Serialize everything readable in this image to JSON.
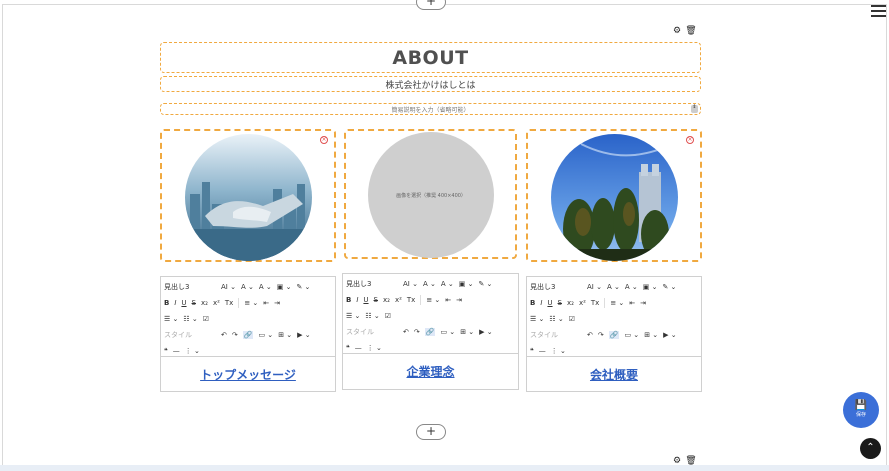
{
  "page": {
    "add_block_label": "+",
    "menu_icon": "hamburger-icon"
  },
  "block_tools": {
    "settings_icon": "⚙",
    "delete_icon": "🗑"
  },
  "about": {
    "title": "ABOUT",
    "subtitle": "株式会社かけはしとは",
    "description_placeholder": "簡易説明を入力（省略可能）",
    "spinner": "⇕"
  },
  "cards": [
    {
      "image_alt": "handshake over city",
      "remove_icon": "×",
      "toolbar": {
        "heading_select": "見出し3",
        "style_select": "スタイル"
      },
      "link_text": "トップメッセージ"
    },
    {
      "placeholder_text": "画像を選択（推奨 400×400）",
      "toolbar": {
        "heading_select": "見出し3",
        "style_select": "スタイル"
      },
      "link_text": "企業理念"
    },
    {
      "image_alt": "buildings and trees under blue sky",
      "remove_icon": "×",
      "toolbar": {
        "heading_select": "見出し3",
        "style_select": "スタイル"
      },
      "link_text": "会社概要"
    }
  ],
  "toolbar_glyphs": {
    "row1": [
      "AI ⌄",
      "A ⌄",
      "A ⌄",
      "▣ ⌄",
      "✎ ⌄"
    ],
    "row2": [
      "B",
      "I",
      "U",
      "S",
      "x₂",
      "x²",
      "Tx",
      "≡ ⌄",
      "⇤",
      "⇥"
    ],
    "row3": [
      "☰ ⌄",
      "☷ ⌄",
      "☑"
    ],
    "row4": [
      "↶",
      "↷",
      "🔗",
      "▭ ⌄",
      "⊞ ⌄",
      "▶ ⌄"
    ],
    "row5": [
      "❝",
      "—",
      "⋮ ⌄"
    ]
  },
  "save_button": {
    "icon": "💾",
    "label": "保存"
  },
  "scroll_top": "⌃",
  "colors": {
    "accent": "#3b6fd8",
    "dashed_border": "#f0a940"
  }
}
